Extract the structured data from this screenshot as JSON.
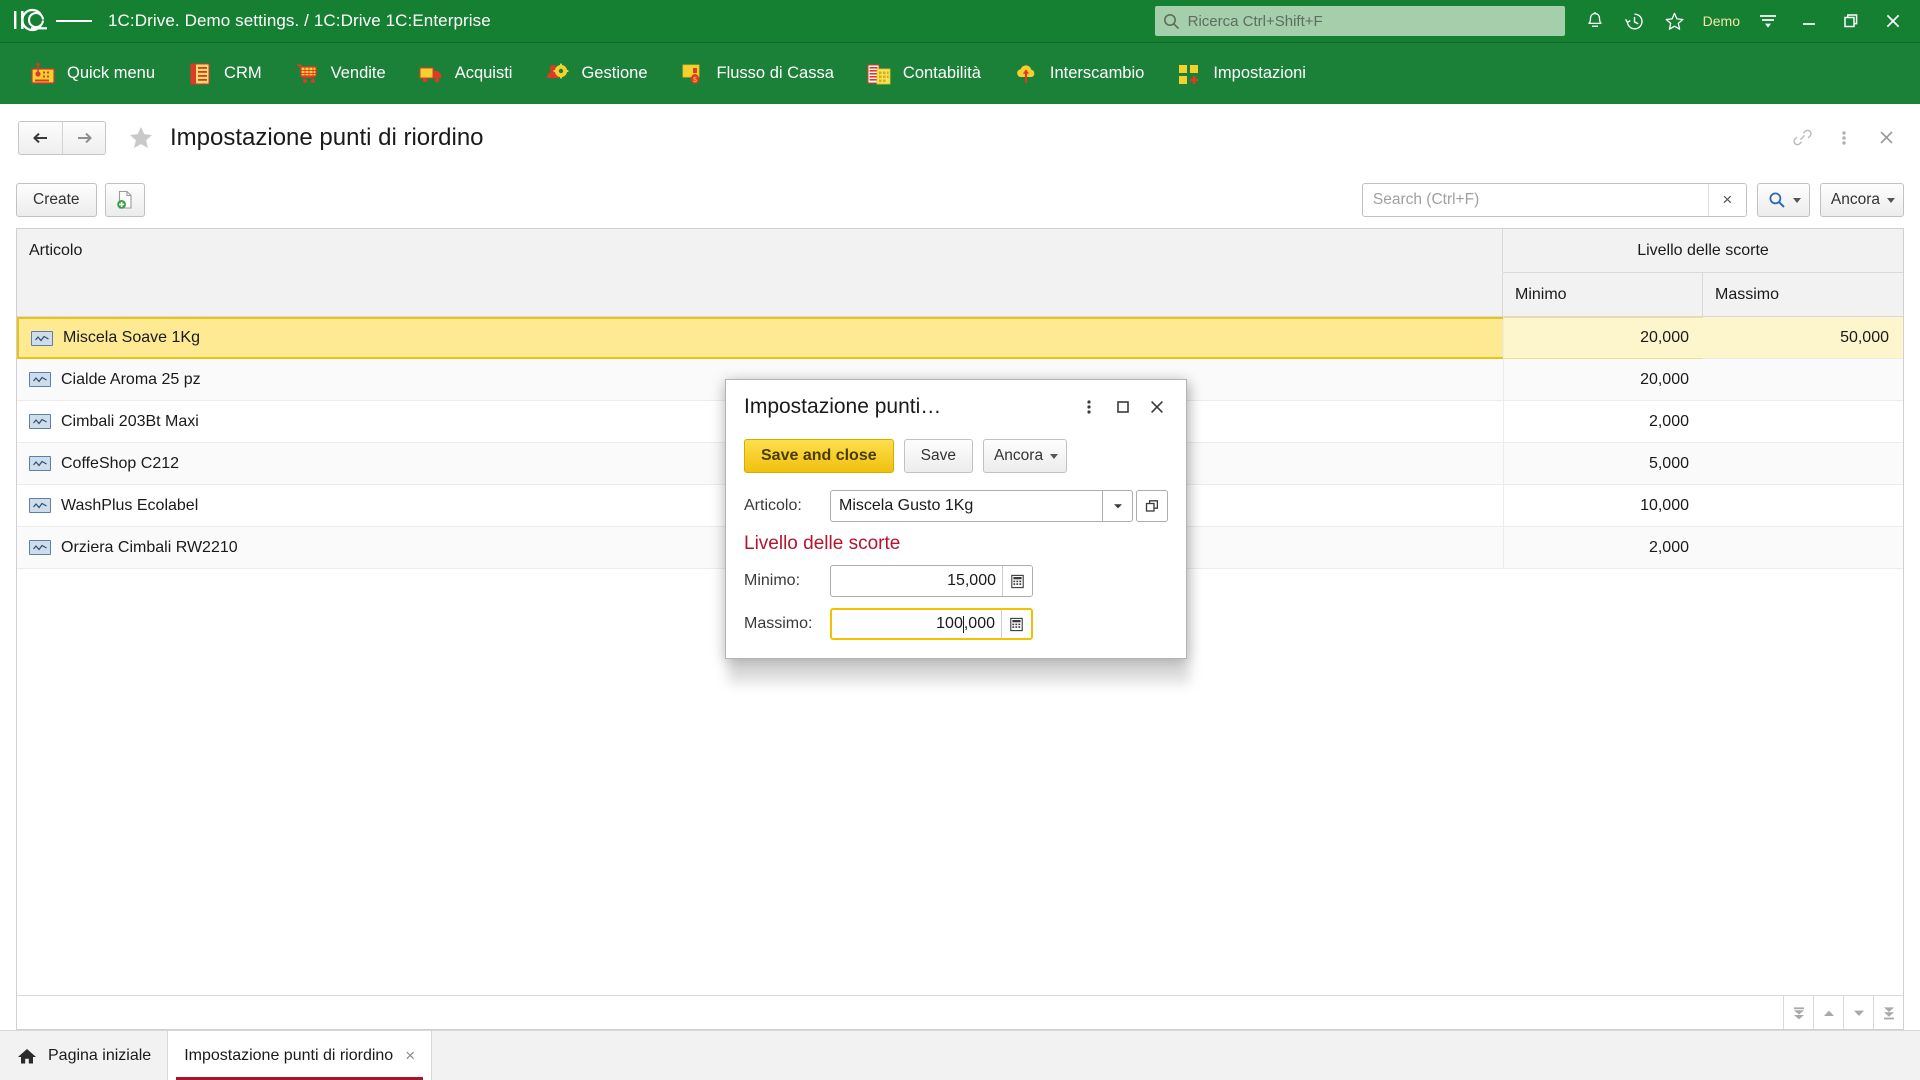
{
  "titlebar": {
    "logo": "1c-logo",
    "app_title": "1C:Drive. Demo settings. / 1C:Drive 1C:Enterprise",
    "search_placeholder": "Ricerca Ctrl+Shift+F",
    "user": "Demo",
    "icons": [
      "bell-icon",
      "history-icon",
      "star-icon",
      "menu-lines-icon"
    ],
    "window_buttons": [
      "minimize-button",
      "restore-button",
      "close-button"
    ]
  },
  "navbar": {
    "items": [
      {
        "label": "Quick menu",
        "icon": "quick-menu-icon"
      },
      {
        "label": "CRM",
        "icon": "crm-icon"
      },
      {
        "label": "Vendite",
        "icon": "sales-cart-icon"
      },
      {
        "label": "Acquisti",
        "icon": "purchase-truck-icon"
      },
      {
        "label": "Gestione",
        "icon": "management-gear-icon"
      },
      {
        "label": "Flusso di Cassa",
        "icon": "cashflow-icon"
      },
      {
        "label": "Contabilità",
        "icon": "accounting-icon"
      },
      {
        "label": "Interscambio",
        "icon": "cloud-exchange-icon"
      },
      {
        "label": "Impostazioni",
        "icon": "settings-tiles-icon"
      }
    ]
  },
  "page_header": {
    "back_icon": "arrow-left-icon",
    "forward_icon": "arrow-right-icon",
    "favorite_icon": "star-icon",
    "title": "Impostazione punti di riordino",
    "actions": [
      "link-icon",
      "kebab-menu-icon",
      "close-icon"
    ]
  },
  "command_bar": {
    "create_label": "Create",
    "create_copy_icon": "new-document-icon",
    "search_placeholder": "Search (Ctrl+F)",
    "search_value": "",
    "search_clear_icon": "clear-icon",
    "search_button_icon": "search-icon",
    "more_label": "Ancora"
  },
  "table": {
    "columns": {
      "articolo": "Articolo",
      "group": "Livello delle scorte",
      "minimo": "Minimo",
      "massimo": "Massimo"
    },
    "rows": [
      {
        "name": "Miscela Soave 1Kg",
        "minimo": "20,000",
        "massimo": "50,000",
        "selected": true
      },
      {
        "name": "Cialde Aroma 25 pz",
        "minimo": "20,000",
        "massimo": "",
        "selected": false
      },
      {
        "name": "Cimbali 203Bt Maxi",
        "minimo": "2,000",
        "massimo": "",
        "selected": false
      },
      {
        "name": "CoffeShop C212",
        "minimo": "5,000",
        "massimo": "",
        "selected": false
      },
      {
        "name": "WashPlus Ecolabel",
        "minimo": "10,000",
        "massimo": "",
        "selected": false
      },
      {
        "name": "Orziera Cimbali RW2210",
        "minimo": "2,000",
        "massimo": "",
        "selected": false
      }
    ],
    "footer_buttons": [
      "scroll-first-icon",
      "scroll-up-icon",
      "scroll-down-icon",
      "scroll-last-icon"
    ]
  },
  "modal": {
    "title": "Impostazione punti…",
    "header_buttons": [
      "kebab-menu-icon",
      "maximize-icon",
      "close-icon"
    ],
    "save_and_close_label": "Save and close",
    "save_label": "Save",
    "more_label": "Ancora",
    "articolo_label": "Articolo:",
    "articolo_value": "Miscela Gusto 1Kg",
    "section_title": "Livello delle scorte",
    "minimo_label": "Minimo:",
    "minimo_value": "15,000",
    "massimo_label": "Massimo:",
    "massimo_value_before_caret": "100",
    "massimo_value_after_caret": ",000",
    "calculator_icon": "calculator-icon"
  },
  "taskbar": {
    "tabs": [
      {
        "label": "Pagina iniziale",
        "icon": "home-icon",
        "active": false,
        "closable": false
      },
      {
        "label": "Impostazione punti di riordino",
        "icon": "",
        "active": true,
        "closable": true
      }
    ],
    "close_icon": "close-icon"
  },
  "colors": {
    "brand_green": "#157f32",
    "nav_green": "#1b8038",
    "accent_yellow": "#efc00c",
    "selection_yellow": "#fdea93",
    "section_red": "#b3152e",
    "tab_underline": "#a8142a"
  }
}
